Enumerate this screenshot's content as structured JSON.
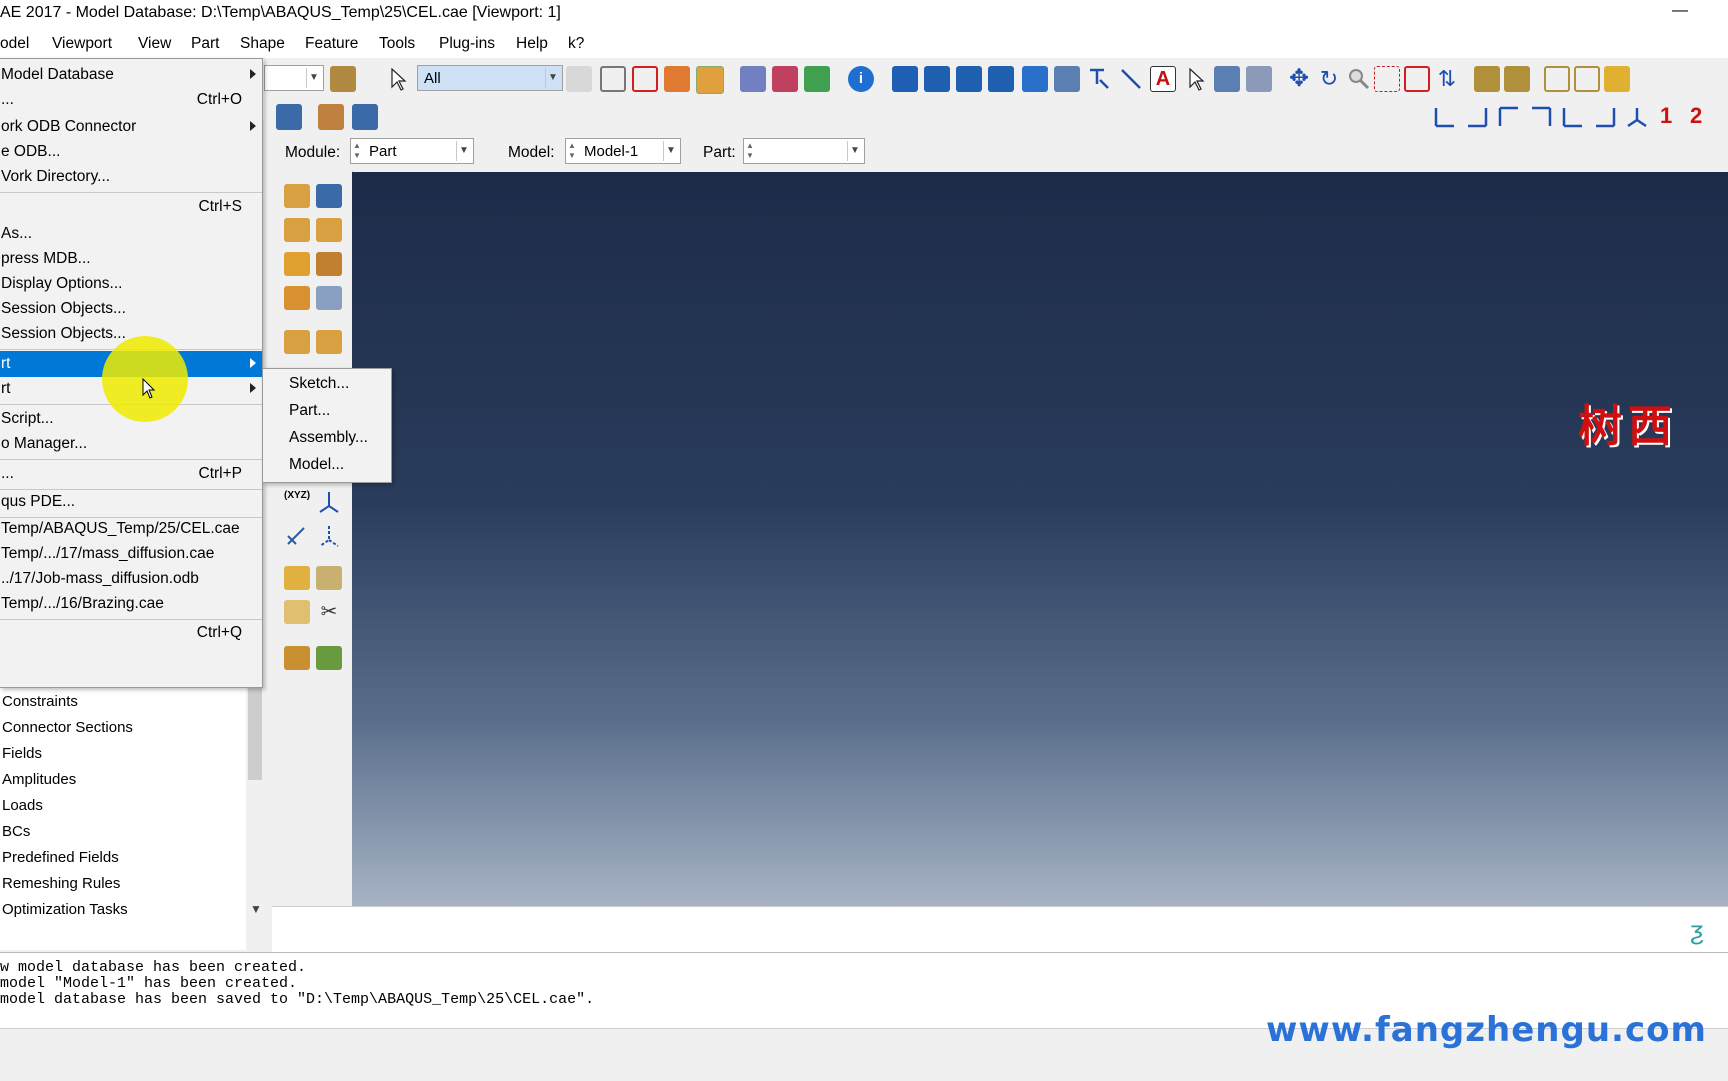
{
  "window": {
    "title": "AE 2017 - Model Database: D:\\Temp\\ABAQUS_Temp\\25\\CEL.cae [Viewport: 1]",
    "minimize": "—"
  },
  "menubar": {
    "items": [
      "odel",
      "Viewport",
      "View",
      "Part",
      "Shape",
      "Feature",
      "Tools",
      "Plug-ins",
      "Help",
      "k?"
    ]
  },
  "toolbar": {
    "selection_filter": "All",
    "axis_numbers": [
      "1",
      "2"
    ]
  },
  "context": {
    "module_label": "Module:",
    "module_value": "Part",
    "model_label": "Model:",
    "model_value": "Model-1",
    "part_label": "Part:",
    "part_value": ""
  },
  "file_menu": {
    "items": [
      {
        "label": "Model Database",
        "shortcut": "",
        "submenu": true
      },
      {
        "label": "...",
        "shortcut": "Ctrl+O",
        "submenu": false
      },
      {
        "label": "ork ODB Connector",
        "shortcut": "",
        "submenu": true
      },
      {
        "label": "e ODB...",
        "shortcut": "",
        "submenu": false
      },
      {
        "label": "Vork Directory...",
        "shortcut": "",
        "submenu": false
      },
      {
        "label": "",
        "shortcut": "Ctrl+S",
        "submenu": false
      },
      {
        "label": "As...",
        "shortcut": "",
        "submenu": false
      },
      {
        "label": "press MDB...",
        "shortcut": "",
        "submenu": false
      },
      {
        "label": "Display Options...",
        "shortcut": "",
        "submenu": false
      },
      {
        "label": "Session Objects...",
        "shortcut": "",
        "submenu": false
      },
      {
        "label": "Session Objects...",
        "shortcut": "",
        "submenu": false
      },
      {
        "label": "rt",
        "shortcut": "",
        "submenu": true
      },
      {
        "label": "rt",
        "shortcut": "",
        "submenu": true
      },
      {
        "label": "Script...",
        "shortcut": "",
        "submenu": false
      },
      {
        "label": "o Manager...",
        "shortcut": "",
        "submenu": false
      },
      {
        "label": "...",
        "shortcut": "Ctrl+P",
        "submenu": false
      },
      {
        "label": "qus PDE...",
        "shortcut": "",
        "submenu": false
      },
      {
        "label": "Temp/ABAQUS_Temp/25/CEL.cae",
        "shortcut": "",
        "submenu": false
      },
      {
        "label": "Temp/.../17/mass_diffusion.cae",
        "shortcut": "",
        "submenu": false
      },
      {
        "label": "../17/Job-mass_diffusion.odb",
        "shortcut": "",
        "submenu": false
      },
      {
        "label": "Temp/.../16/Brazing.cae",
        "shortcut": "",
        "submenu": false
      },
      {
        "label": "",
        "shortcut": "Ctrl+Q",
        "submenu": false
      }
    ]
  },
  "import_submenu": {
    "items": [
      "Sketch...",
      "Part...",
      "Assembly...",
      "Model..."
    ]
  },
  "model_tree": {
    "items": [
      "Constraints",
      "Connector Sections",
      "Fields",
      "Amplitudes",
      "Loads",
      "BCs",
      "Predefined Fields",
      "Remeshing Rules",
      "Optimization Tasks"
    ]
  },
  "messages": [
    "w model database has been created.",
    "model \"Model-1\" has been created.",
    "model database has been saved to \"D:\\Temp\\ABAQUS_Temp\\25\\CEL.cae\"."
  ],
  "overlays": {
    "cn_watermark": "树西",
    "site": "www.fangzhengu.com"
  },
  "colors": {
    "viewport_top": "#1c2b48",
    "viewport_bottom": "#a7b3c5",
    "menu_highlight": "#0078d7",
    "watermark": "#d01010"
  }
}
